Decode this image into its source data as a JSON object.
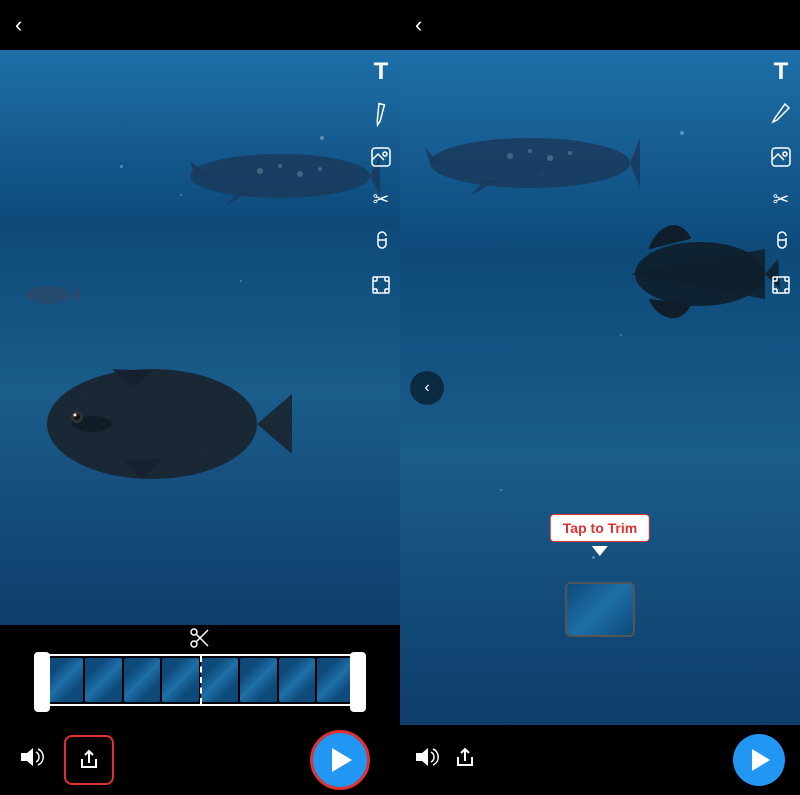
{
  "leftPanel": {
    "backArrow": "‹",
    "toolbar": {
      "textIcon": "T",
      "penIcon": "✏",
      "stickerIcon": "⊟",
      "scissorsIcon": "✂",
      "clipIcon": "📎",
      "cropIcon": "⬚"
    },
    "timeline": {
      "scissorsLabel": "✂",
      "frameCount": 8
    },
    "bottomControls": {
      "volumeIcon": "🔊",
      "shareIcon": "⬆",
      "playIcon": "▶"
    }
  },
  "rightPanel": {
    "backArrow": "‹",
    "toolbar": {
      "textIcon": "T",
      "penIcon": "✏",
      "stickerIcon": "⊟",
      "scissorsIcon": "✂",
      "clipIcon": "📎",
      "cropIcon": "⬚"
    },
    "tapToTrim": {
      "label": "Tap to Trim",
      "dash": "-"
    },
    "navArrow": "‹",
    "bottomControls": {
      "volumeIcon": "🔊",
      "shareIcon": "⬆",
      "playIcon": "▶"
    }
  },
  "colors": {
    "background": "#000000",
    "accent": "#2196f3",
    "redBorder": "#e03030",
    "white": "#ffffff"
  }
}
